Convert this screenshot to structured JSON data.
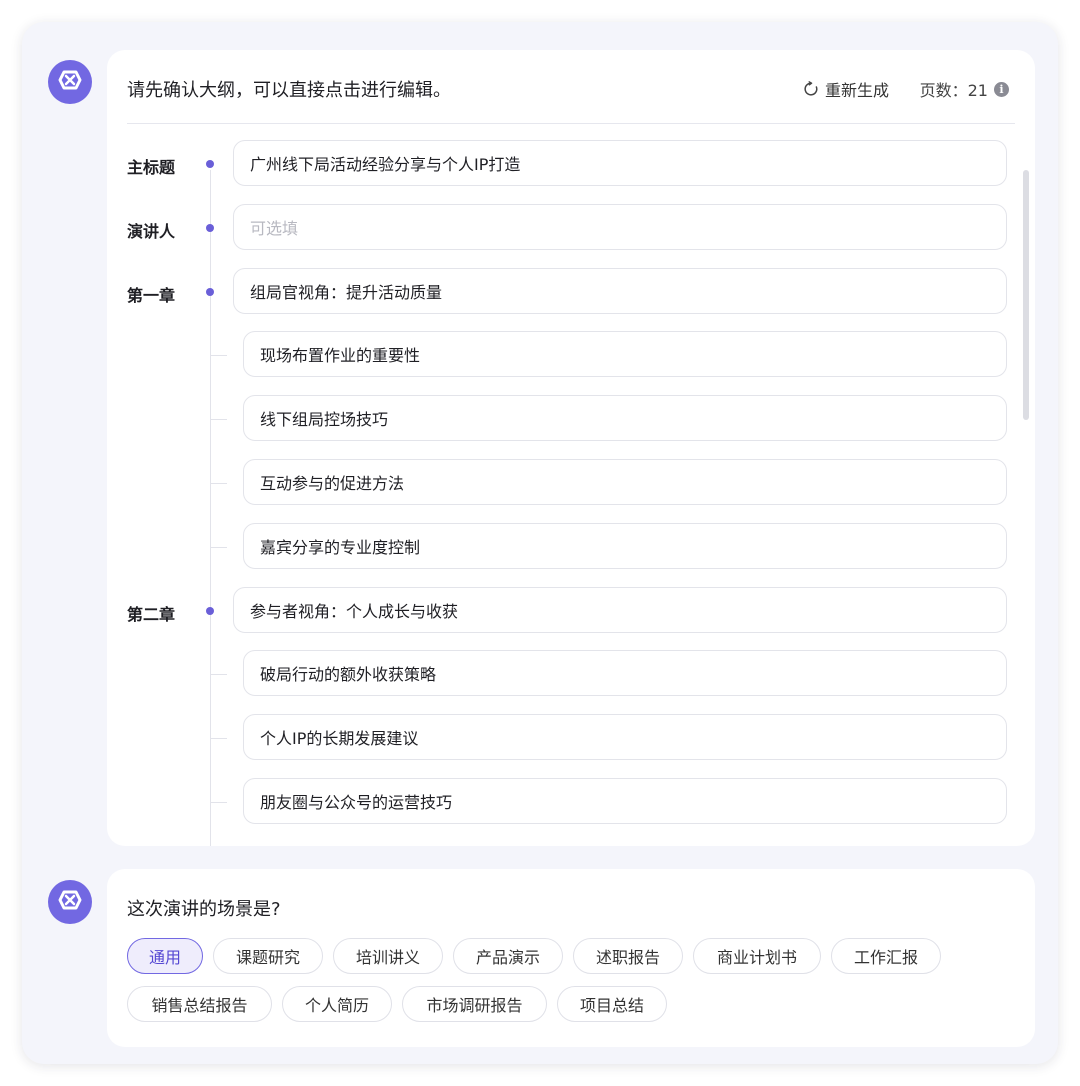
{
  "outline": {
    "prompt": "请先确认大纲，可以直接点击进行编辑。",
    "regenerate_label": "重新生成",
    "pages_label": "页数：21",
    "rows": [
      {
        "label": "主标题",
        "text": "广州线下局活动经验分享与个人IP打造"
      },
      {
        "label": "演讲人",
        "placeholder": "可选填"
      },
      {
        "label": "第一章",
        "text": "组局官视角：提升活动质量"
      },
      {
        "text": "现场布置作业的重要性"
      },
      {
        "text": "线下组局控场技巧"
      },
      {
        "text": "互动参与的促进方法"
      },
      {
        "text": "嘉宾分享的专业度控制"
      },
      {
        "label": "第二章",
        "text": "参与者视角：个人成长与收获"
      },
      {
        "text": "破局行动的额外收获策略"
      },
      {
        "text": "个人IP的长期发展建议"
      },
      {
        "text": "朋友圈与公众号的运营技巧"
      }
    ]
  },
  "scenario": {
    "question": "这次演讲的场景是?",
    "selected": "通用",
    "options": [
      "通用",
      "课题研究",
      "培训讲义",
      "产品演示",
      "述职报告",
      "商业计划书",
      "工作汇报",
      "销售总结报告",
      "个人简历",
      "市场调研报告",
      "项目总结"
    ]
  },
  "colors": {
    "accent": "#7268e2",
    "dot": "#6a5fd8"
  },
  "icons": {
    "assistant": "assistant-logo-icon",
    "regenerate": "refresh-icon",
    "info": "info-icon"
  }
}
